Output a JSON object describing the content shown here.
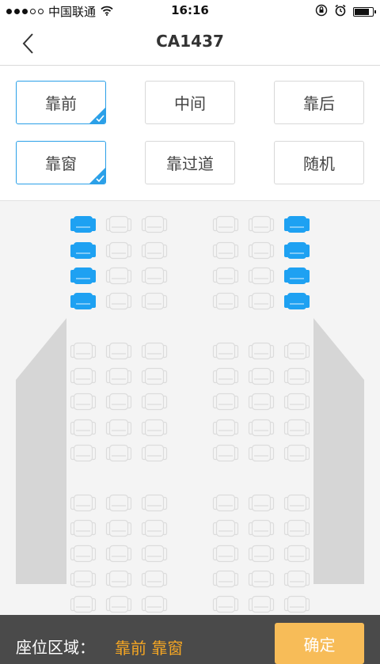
{
  "status_bar": {
    "carrier": "中国联通",
    "time": "16:16",
    "signal_filled": 3,
    "signal_total": 5,
    "battery_level": 0.85,
    "icons": [
      "signal-dots-icon",
      "wifi-icon",
      "rotation-lock-icon",
      "alarm-icon",
      "battery-icon"
    ]
  },
  "nav": {
    "title": "CA1437",
    "back_icon": "chevron-left-icon"
  },
  "options": {
    "row1": [
      {
        "label": "靠前",
        "selected": true
      },
      {
        "label": "中间",
        "selected": false
      },
      {
        "label": "靠后",
        "selected": false
      }
    ],
    "row2": [
      {
        "label": "靠窗",
        "selected": true
      },
      {
        "label": "靠过道",
        "selected": false
      },
      {
        "label": "随机",
        "selected": false
      }
    ]
  },
  "seat_map": {
    "icon": "seat-icon",
    "left_columns": 3,
    "right_columns": 3,
    "highlighted_rows": 4,
    "highlighted_columns": [
      "left-window",
      "right-window"
    ]
  },
  "bottom": {
    "zone_label": "座位区域：",
    "zone_value": "靠前 靠窗",
    "confirm_label": "确定"
  },
  "colors": {
    "accent": "#2ba0e8",
    "seat_selected": "#1ea1f2",
    "seat_default": "#dcdcdc",
    "confirm": "#f7bc58",
    "zone_value": "#f5a623",
    "bottom_bar": "#4a4a4a"
  }
}
